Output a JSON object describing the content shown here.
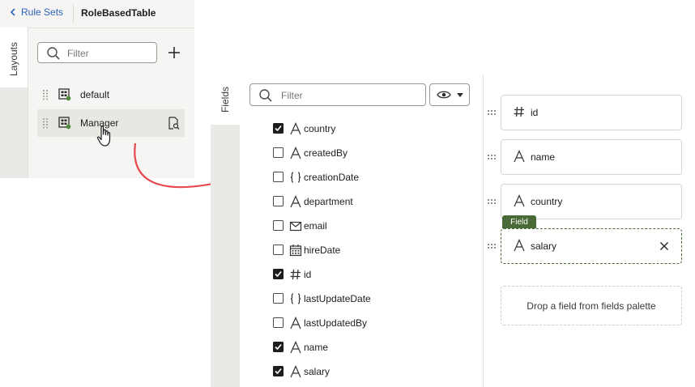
{
  "header": {
    "back_label": "Rule Sets",
    "title": "RoleBasedTable"
  },
  "layouts": {
    "tab_label": "Layouts",
    "filter_placeholder": "Filter",
    "items": [
      {
        "label": "default",
        "selected": false
      },
      {
        "label": "Manager",
        "selected": true
      }
    ]
  },
  "fields": {
    "tab_label": "Fields",
    "filter_placeholder": "Filter",
    "items": [
      {
        "label": "country",
        "type": "text",
        "checked": true
      },
      {
        "label": "createdBy",
        "type": "text",
        "checked": false
      },
      {
        "label": "creationDate",
        "type": "object",
        "checked": false
      },
      {
        "label": "department",
        "type": "text",
        "checked": false
      },
      {
        "label": "email",
        "type": "email",
        "checked": false
      },
      {
        "label": "hireDate",
        "type": "date",
        "checked": false
      },
      {
        "label": "id",
        "type": "number",
        "checked": true
      },
      {
        "label": "lastUpdateDate",
        "type": "object",
        "checked": false
      },
      {
        "label": "lastUpdatedBy",
        "type": "text",
        "checked": false
      },
      {
        "label": "name",
        "type": "text",
        "checked": true
      },
      {
        "label": "salary",
        "type": "text",
        "checked": true
      }
    ],
    "type_glyphs": {
      "text": "A",
      "object": "{ }",
      "number": "#"
    }
  },
  "layout_fields": {
    "cards": [
      {
        "label": "id",
        "type": "number"
      },
      {
        "label": "name",
        "type": "text"
      },
      {
        "label": "country",
        "type": "text"
      },
      {
        "label": "salary",
        "type": "text",
        "selected": true
      }
    ],
    "selected_tag": "Field",
    "drop_hint": "Drop a field from fields palette"
  },
  "colors": {
    "link": "#2a63b8",
    "accent_green": "#4a6b37",
    "arrow_red": "#e5484d",
    "status_green": "#4f8a3a"
  },
  "icons": {
    "back": "chevron-left-icon",
    "search": "search-icon",
    "add": "plus-icon",
    "drag": "drag-handle-icon",
    "layout": "layout-grid-icon",
    "preview": "preview-icon",
    "pointer": "pointer-hand-icon",
    "view": "eye-icon",
    "close": "close-icon"
  }
}
